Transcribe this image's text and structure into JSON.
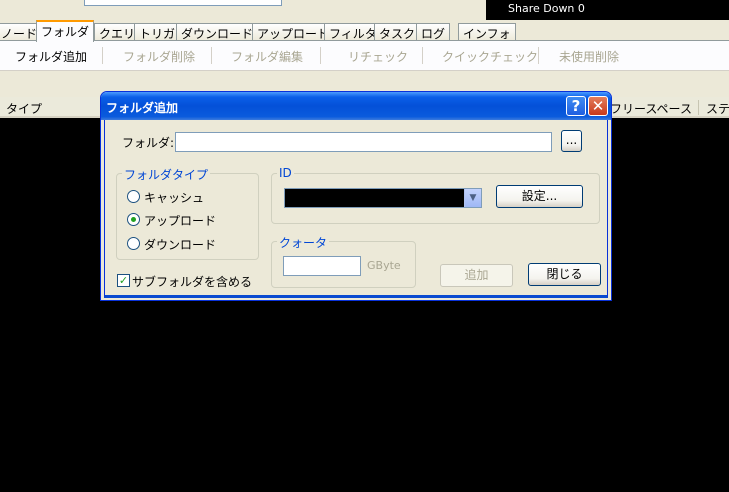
{
  "topbar": {
    "share_down": "Share Down 0"
  },
  "tabs": [
    "ノード",
    "フォルダ",
    "クエリ",
    "トリガ",
    "ダウンロード",
    "アップロード",
    "フィルタ",
    "タスク",
    "ログ",
    "インフォ"
  ],
  "active_tab": "フォルダ",
  "toolbar": {
    "add": "フォルダ追加",
    "delete": "フォルダ削除",
    "edit": "フォルダ編集",
    "recheck": "リチェック",
    "quickcheck": "クイックチェック",
    "delete_unused": "未使用削除"
  },
  "list_header": {
    "col_type": "タイプ",
    "col_free": "フリースペース",
    "col_status": "ステ"
  },
  "dialog": {
    "title": "フォルダ追加",
    "help_glyph": "?",
    "close_glyph": "✕",
    "folder_label": "フォルダ:",
    "folder_value": "",
    "browse_label": "...",
    "folder_type_group": "フォルダタイプ",
    "radio_cache": "キャッシュ",
    "radio_upload": "アップロード",
    "radio_download": "ダウンロード",
    "selected_type": "アップロード",
    "id_group": "ID",
    "id_value": "",
    "settings_button": "設定...",
    "quota_group": "クォータ",
    "quota_value": "",
    "quota_unit": "GByte",
    "include_subfolders": "サブフォルダを含める",
    "include_subfolders_checked": true,
    "add_button": "追加",
    "close_button": "閉じる"
  },
  "colors": {
    "titlebar": "#0450d8",
    "accent_tab": "#ff9a00",
    "group_title": "#0046d5",
    "check": "#21a121"
  }
}
